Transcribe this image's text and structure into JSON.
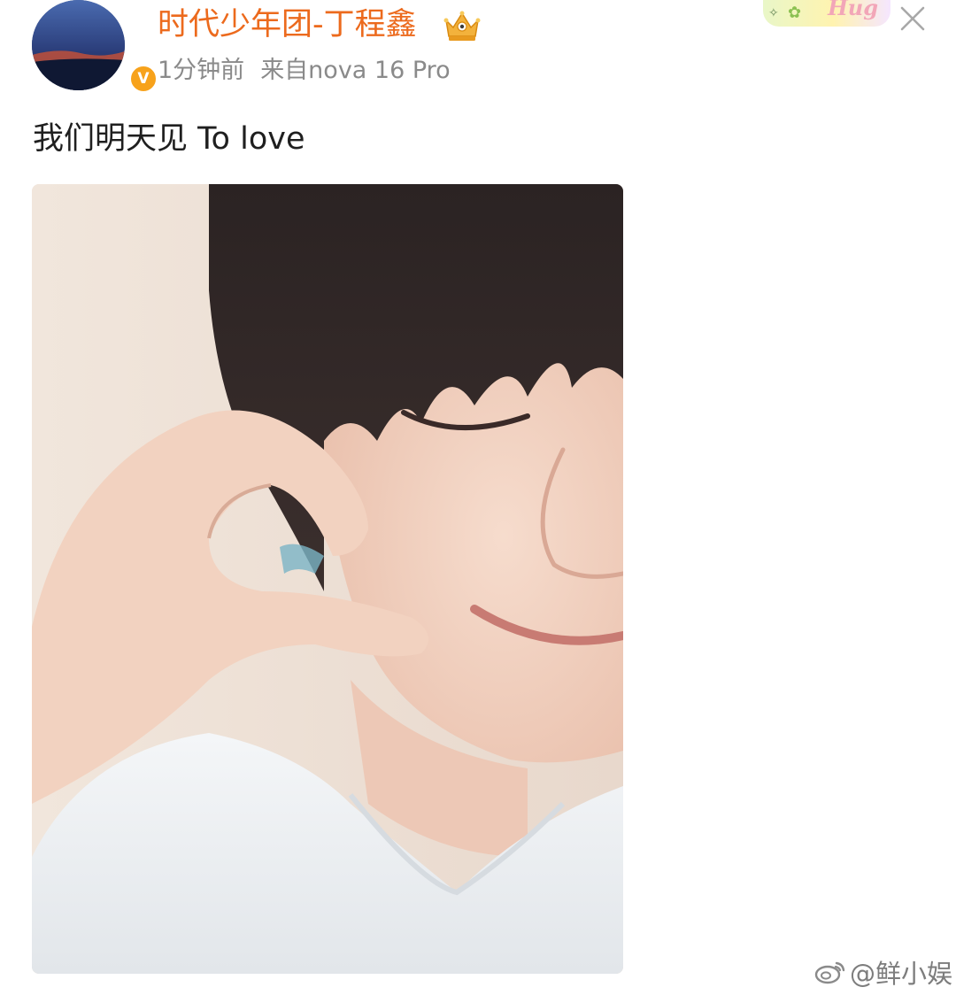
{
  "post": {
    "author": {
      "name": "时代少年团-丁程鑫",
      "verified_badge": "V",
      "name_color": "#ec6a1d",
      "badge_color": "#f7a21b"
    },
    "time": "1分钟前",
    "source": "来自nova 16 Pro",
    "text": "我们明天见 To love",
    "image_description_icon": "photo"
  },
  "decor": {
    "sticker_text": "Hug",
    "sticker_flower": "✿",
    "sticker_sparkle": "✧"
  },
  "watermark": {
    "handle": "@鲜小娱",
    "icon": "weibo-logo-icon"
  }
}
